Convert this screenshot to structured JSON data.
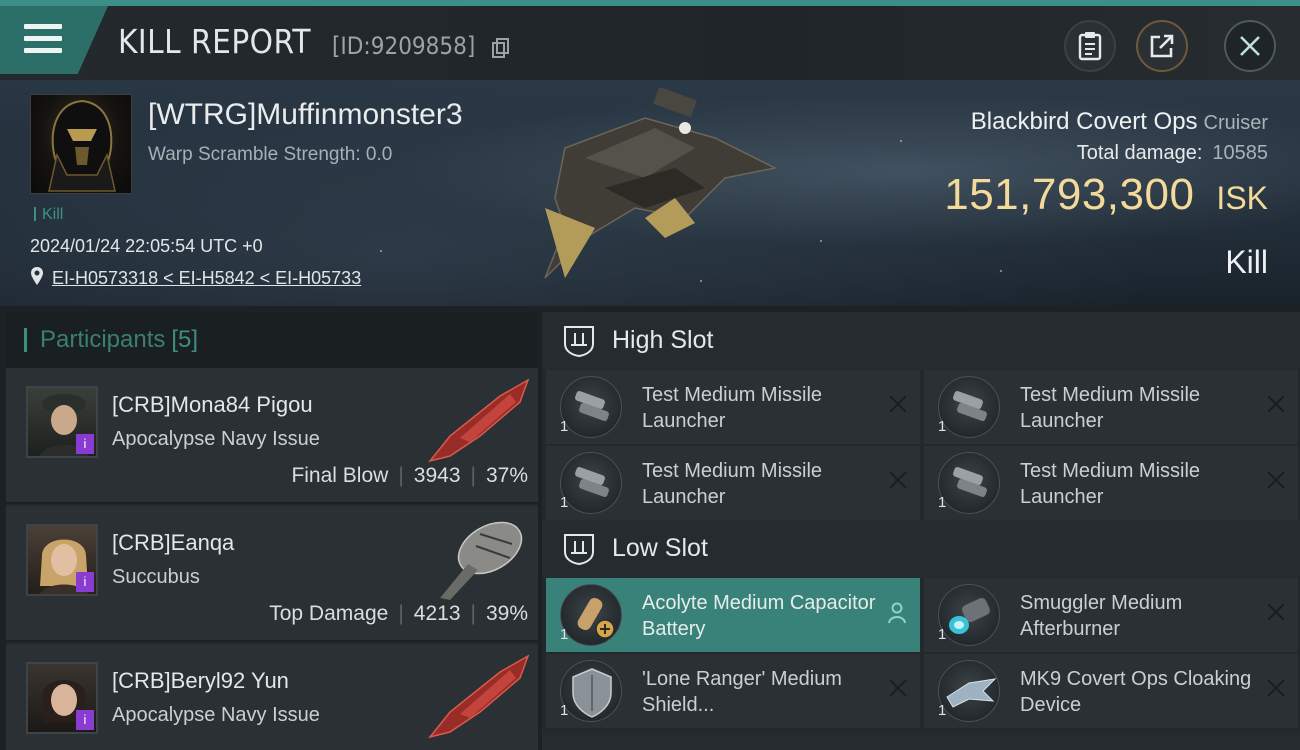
{
  "header": {
    "title": "KILL REPORT",
    "report_id": "[ID:9209858]",
    "icons": [
      "menu-icon",
      "copy-icon",
      "clipboard-icon",
      "share-icon",
      "close-icon"
    ]
  },
  "victim": {
    "pilot": "[WTRG]Muffinmonster3",
    "warp_scramble": "Warp Scramble Strength: 0.0",
    "tag": "Kill",
    "datetime": "2024/01/24 22:05:54 UTC +0",
    "location": "EI-H0573318 < EI-H5842 < EI-H05733",
    "ship": "Blackbird Covert Ops",
    "ship_class": "Cruiser",
    "total_damage_label": "Total damage:",
    "total_damage": "10585",
    "isk_value": "151,793,300",
    "isk_unit": "ISK",
    "result": "Kill"
  },
  "participants": {
    "title": "Participants",
    "count": "[5]",
    "rows": [
      {
        "name": "[CRB]Mona84 Pigou",
        "ship": "Apocalypse Navy Issue",
        "role": "Final Blow",
        "damage": "3943",
        "percent": "37%"
      },
      {
        "name": "[CRB]Eanqa",
        "ship": "Succubus",
        "role": "Top Damage",
        "damage": "4213",
        "percent": "39%"
      },
      {
        "name": "[CRB]Beryl92 Yun",
        "ship": "Apocalypse Navy Issue",
        "role": "",
        "damage": "",
        "percent": ""
      }
    ]
  },
  "slots": {
    "high": {
      "label": "High Slot",
      "modules": [
        {
          "name": "Test Medium Missile Launcher",
          "qty": "1"
        },
        {
          "name": "Test Medium Missile Launcher",
          "qty": "1"
        },
        {
          "name": "Test Medium Missile Launcher",
          "qty": "1"
        },
        {
          "name": "Test Medium Missile Launcher",
          "qty": "1"
        }
      ]
    },
    "low": {
      "label": "Low Slot",
      "modules": [
        {
          "name": "Acolyte Medium Capacitor Battery",
          "qty": "1"
        },
        {
          "name": "Smuggler Medium Afterburner",
          "qty": "1"
        },
        {
          "name": "'Lone Ranger' Medium Shield...",
          "qty": "1"
        },
        {
          "name": "MK9 Covert Ops Cloaking Device",
          "qty": "1"
        }
      ]
    }
  },
  "colors": {
    "accent": "#3f8f80",
    "isk": "#f3d99a",
    "highlight": "#39827a"
  }
}
